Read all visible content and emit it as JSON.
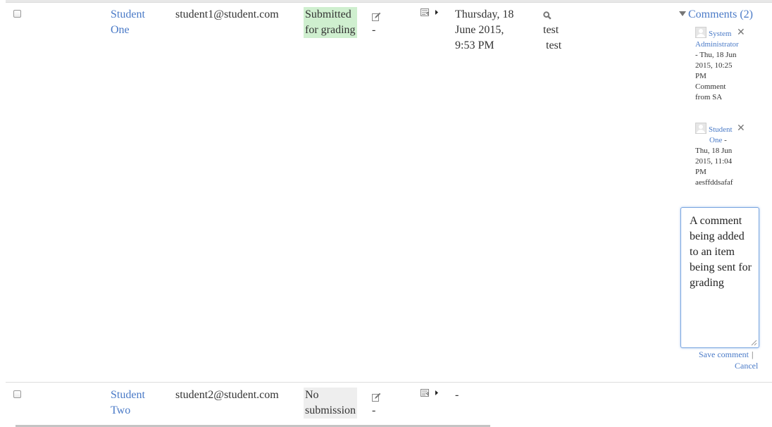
{
  "rows": [
    {
      "name": "Student One",
      "name_line1": "Student",
      "name_line2": "One",
      "email": "student1@student.com",
      "status_line1": "Submitted",
      "status_line2": "for grading",
      "grade": "-",
      "last_modified_line1": "Thursday, 18",
      "last_modified_line2": "June 2015,",
      "last_modified_line3": "9:53 PM",
      "submission_text_1": "test",
      "submission_text_2": "test",
      "comments_toggle": "Comments (2)",
      "comments": [
        {
          "author_line1": "System",
          "author_line2": "Administrator",
          "meta_line1": "- Thu, 18 Jun",
          "meta_line2": "2015, 10:25",
          "meta_line3": "PM",
          "text_line1": "Comment",
          "text_line2": "from SA"
        },
        {
          "author_line1": "Student",
          "author_line2": "One",
          "author_suffix": " -",
          "meta_line1": "Thu, 18 Jun",
          "meta_line2": "2015, 11:04",
          "meta_line3": "PM",
          "text_line1": "aesffddsafaf"
        }
      ],
      "new_comment_value": "A comment being added to an item being sent for grading",
      "save_comment_label": "Save comment",
      "separator": "|",
      "cancel_label": "Cancel",
      "status_color": "#cfefcf"
    },
    {
      "name": "Student Two",
      "name_line1": "Student",
      "name_line2": "Two",
      "email": "student2@student.com",
      "status_line1": "No",
      "status_line2": "submission",
      "grade": "-",
      "last_modified": "-",
      "status_color": "#eeeeee"
    }
  ],
  "icons": {
    "grade_edit": "edit-icon",
    "actions_menu": "menu-icon",
    "view_submission": "search-icon",
    "delete_comment": "close-icon",
    "comments_toggle": "triangle-down-icon",
    "avatar": "user-avatar-icon"
  },
  "colors": {
    "link": "#4a7ac7",
    "submitted_bg": "#cfefcf",
    "no_submission_bg": "#eeeeee",
    "textarea_focus_border": "#7aa6e0"
  }
}
